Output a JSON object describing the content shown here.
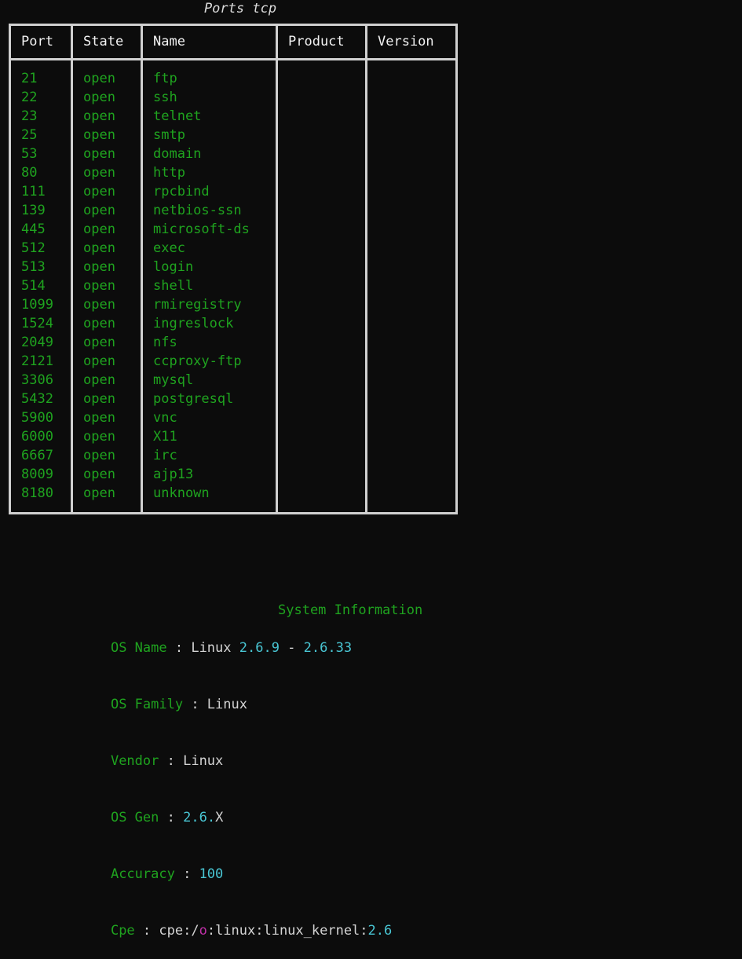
{
  "colors": {
    "background": "#0c0c0c",
    "green": "#1fa31f",
    "white": "#d4d4d4",
    "cyan": "#49c6d4",
    "magenta": "#c030a8",
    "border": "#d0d0d0"
  },
  "ports_table": {
    "title": "Ports tcp",
    "columns": [
      "Port",
      "State",
      "Name",
      "Product",
      "Version"
    ],
    "rows": [
      {
        "port": "21",
        "state": "open",
        "name": "ftp",
        "product": "",
        "version": ""
      },
      {
        "port": "22",
        "state": "open",
        "name": "ssh",
        "product": "",
        "version": ""
      },
      {
        "port": "23",
        "state": "open",
        "name": "telnet",
        "product": "",
        "version": ""
      },
      {
        "port": "25",
        "state": "open",
        "name": "smtp",
        "product": "",
        "version": ""
      },
      {
        "port": "53",
        "state": "open",
        "name": "domain",
        "product": "",
        "version": ""
      },
      {
        "port": "80",
        "state": "open",
        "name": "http",
        "product": "",
        "version": ""
      },
      {
        "port": "111",
        "state": "open",
        "name": "rpcbind",
        "product": "",
        "version": ""
      },
      {
        "port": "139",
        "state": "open",
        "name": "netbios-ssn",
        "product": "",
        "version": ""
      },
      {
        "port": "445",
        "state": "open",
        "name": "microsoft-ds",
        "product": "",
        "version": ""
      },
      {
        "port": "512",
        "state": "open",
        "name": "exec",
        "product": "",
        "version": ""
      },
      {
        "port": "513",
        "state": "open",
        "name": "login",
        "product": "",
        "version": ""
      },
      {
        "port": "514",
        "state": "open",
        "name": "shell",
        "product": "",
        "version": ""
      },
      {
        "port": "1099",
        "state": "open",
        "name": "rmiregistry",
        "product": "",
        "version": ""
      },
      {
        "port": "1524",
        "state": "open",
        "name": "ingreslock",
        "product": "",
        "version": ""
      },
      {
        "port": "2049",
        "state": "open",
        "name": "nfs",
        "product": "",
        "version": ""
      },
      {
        "port": "2121",
        "state": "open",
        "name": "ccproxy-ftp",
        "product": "",
        "version": ""
      },
      {
        "port": "3306",
        "state": "open",
        "name": "mysql",
        "product": "",
        "version": ""
      },
      {
        "port": "5432",
        "state": "open",
        "name": "postgresql",
        "product": "",
        "version": ""
      },
      {
        "port": "5900",
        "state": "open",
        "name": "vnc",
        "product": "",
        "version": ""
      },
      {
        "port": "6000",
        "state": "open",
        "name": "X11",
        "product": "",
        "version": ""
      },
      {
        "port": "6667",
        "state": "open",
        "name": "irc",
        "product": "",
        "version": ""
      },
      {
        "port": "8009",
        "state": "open",
        "name": "ajp13",
        "product": "",
        "version": ""
      },
      {
        "port": "8180",
        "state": "open",
        "name": "unknown",
        "product": "",
        "version": ""
      }
    ]
  },
  "system_information": {
    "title": "System Information",
    "fields": [
      {
        "label": "OS Name",
        "separator": " : ",
        "value": "Linux 2.6.9 - 2.6.33"
      },
      {
        "label": "OS Family",
        "separator": " : ",
        "value": "Linux"
      },
      {
        "label": "Vendor",
        "separator": " : ",
        "value": "Linux"
      },
      {
        "label": "OS Gen",
        "separator": " : ",
        "value": "2.6.X"
      },
      {
        "label": "Accuracy",
        "separator": " : ",
        "value": "100"
      },
      {
        "label": "Cpe",
        "separator": " : ",
        "value": "cpe:/o:linux:linux_kernel:2.6"
      }
    ],
    "os_name": {
      "prefix": "Linux ",
      "version_low": "2.6.9",
      "dash": " - ",
      "version_high": "2.6.33"
    },
    "os_family_value": "Linux",
    "vendor_value": "Linux",
    "os_gen": {
      "num": "2.6",
      "dot": ".",
      "suffix": "X"
    },
    "accuracy_value": "100",
    "cpe": {
      "head": "cpe:/",
      "part": "o",
      "mid": ":linux:linux_kernel:",
      "version": "2.6"
    }
  }
}
